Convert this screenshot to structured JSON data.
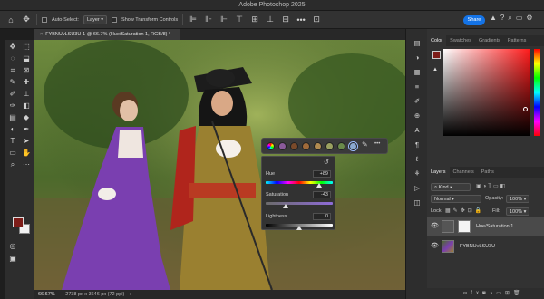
{
  "app": {
    "title": "Adobe Photoshop 2025"
  },
  "options_bar": {
    "auto_select_label": "Auto-Select:",
    "auto_select_target": "Layer",
    "show_transform_label": "Show Transform Controls",
    "more_glyph": "•••",
    "share_label": "Share"
  },
  "document": {
    "tab_title": "FYBNUvLSU3U-1 @ 66.7% (Hue/Saturation 1, RGB/8) *",
    "close_glyph": "×",
    "zoom": "66.67%",
    "dimensions": "2738 px x 3646 px (72 ppi)",
    "status_arrow": "›"
  },
  "toolbar": {
    "tools": [
      "move-tool",
      "marquee-tool",
      "lasso-tool",
      "object-select-tool",
      "crop-tool",
      "frame-tool",
      "eyedropper-tool",
      "spot-heal-tool",
      "brush-tool",
      "stamp-tool",
      "history-brush-tool",
      "eraser-tool",
      "gradient-tool",
      "blur-tool",
      "dodge-tool",
      "pen-tool",
      "type-tool",
      "path-select-tool",
      "rectangle-tool",
      "hand-tool",
      "zoom-tool"
    ],
    "foreground_color": "#7e1d19",
    "background_color": "#f2f2f2"
  },
  "properties": {
    "hue_label": "Hue",
    "hue_value": "+89",
    "saturation_label": "Saturation",
    "saturation_value": "-43",
    "lightness_label": "Lightness",
    "lightness_value": "0",
    "reset_glyph": "↺"
  },
  "swatch_bar": {
    "colors": [
      "#8a5a9a",
      "#7a4a2a",
      "#a06a3a",
      "#b08a50",
      "#9aa060",
      "#6a8a4a",
      "#3a5a3a",
      "#8aa8d0"
    ],
    "more_glyph": "•••"
  },
  "color_panel": {
    "tabs": [
      "Color",
      "Swatches",
      "Gradients",
      "Patterns"
    ],
    "active_tab": "Color",
    "hue_color": "#ff1a1a",
    "foreground_color": "#7e1d19"
  },
  "layers_panel": {
    "tabs": [
      "Layers",
      "Channels",
      "Paths"
    ],
    "kind_label": "Kind",
    "blend_mode": "Normal",
    "opacity_label": "Opacity:",
    "opacity_value": "100%",
    "lock_label": "Lock:",
    "fill_label": "Fill:",
    "fill_value": "100%",
    "layers": [
      {
        "name": "Hue/Saturation 1",
        "type": "adjustment",
        "selected": true
      },
      {
        "name": "FYBNUvLSU3U",
        "type": "pixel",
        "selected": false
      }
    ],
    "footer_icons": [
      "link-icon",
      "fx-icon",
      "mask-icon",
      "adjustment-icon",
      "group-icon",
      "new-layer-icon",
      "trash-icon"
    ]
  }
}
